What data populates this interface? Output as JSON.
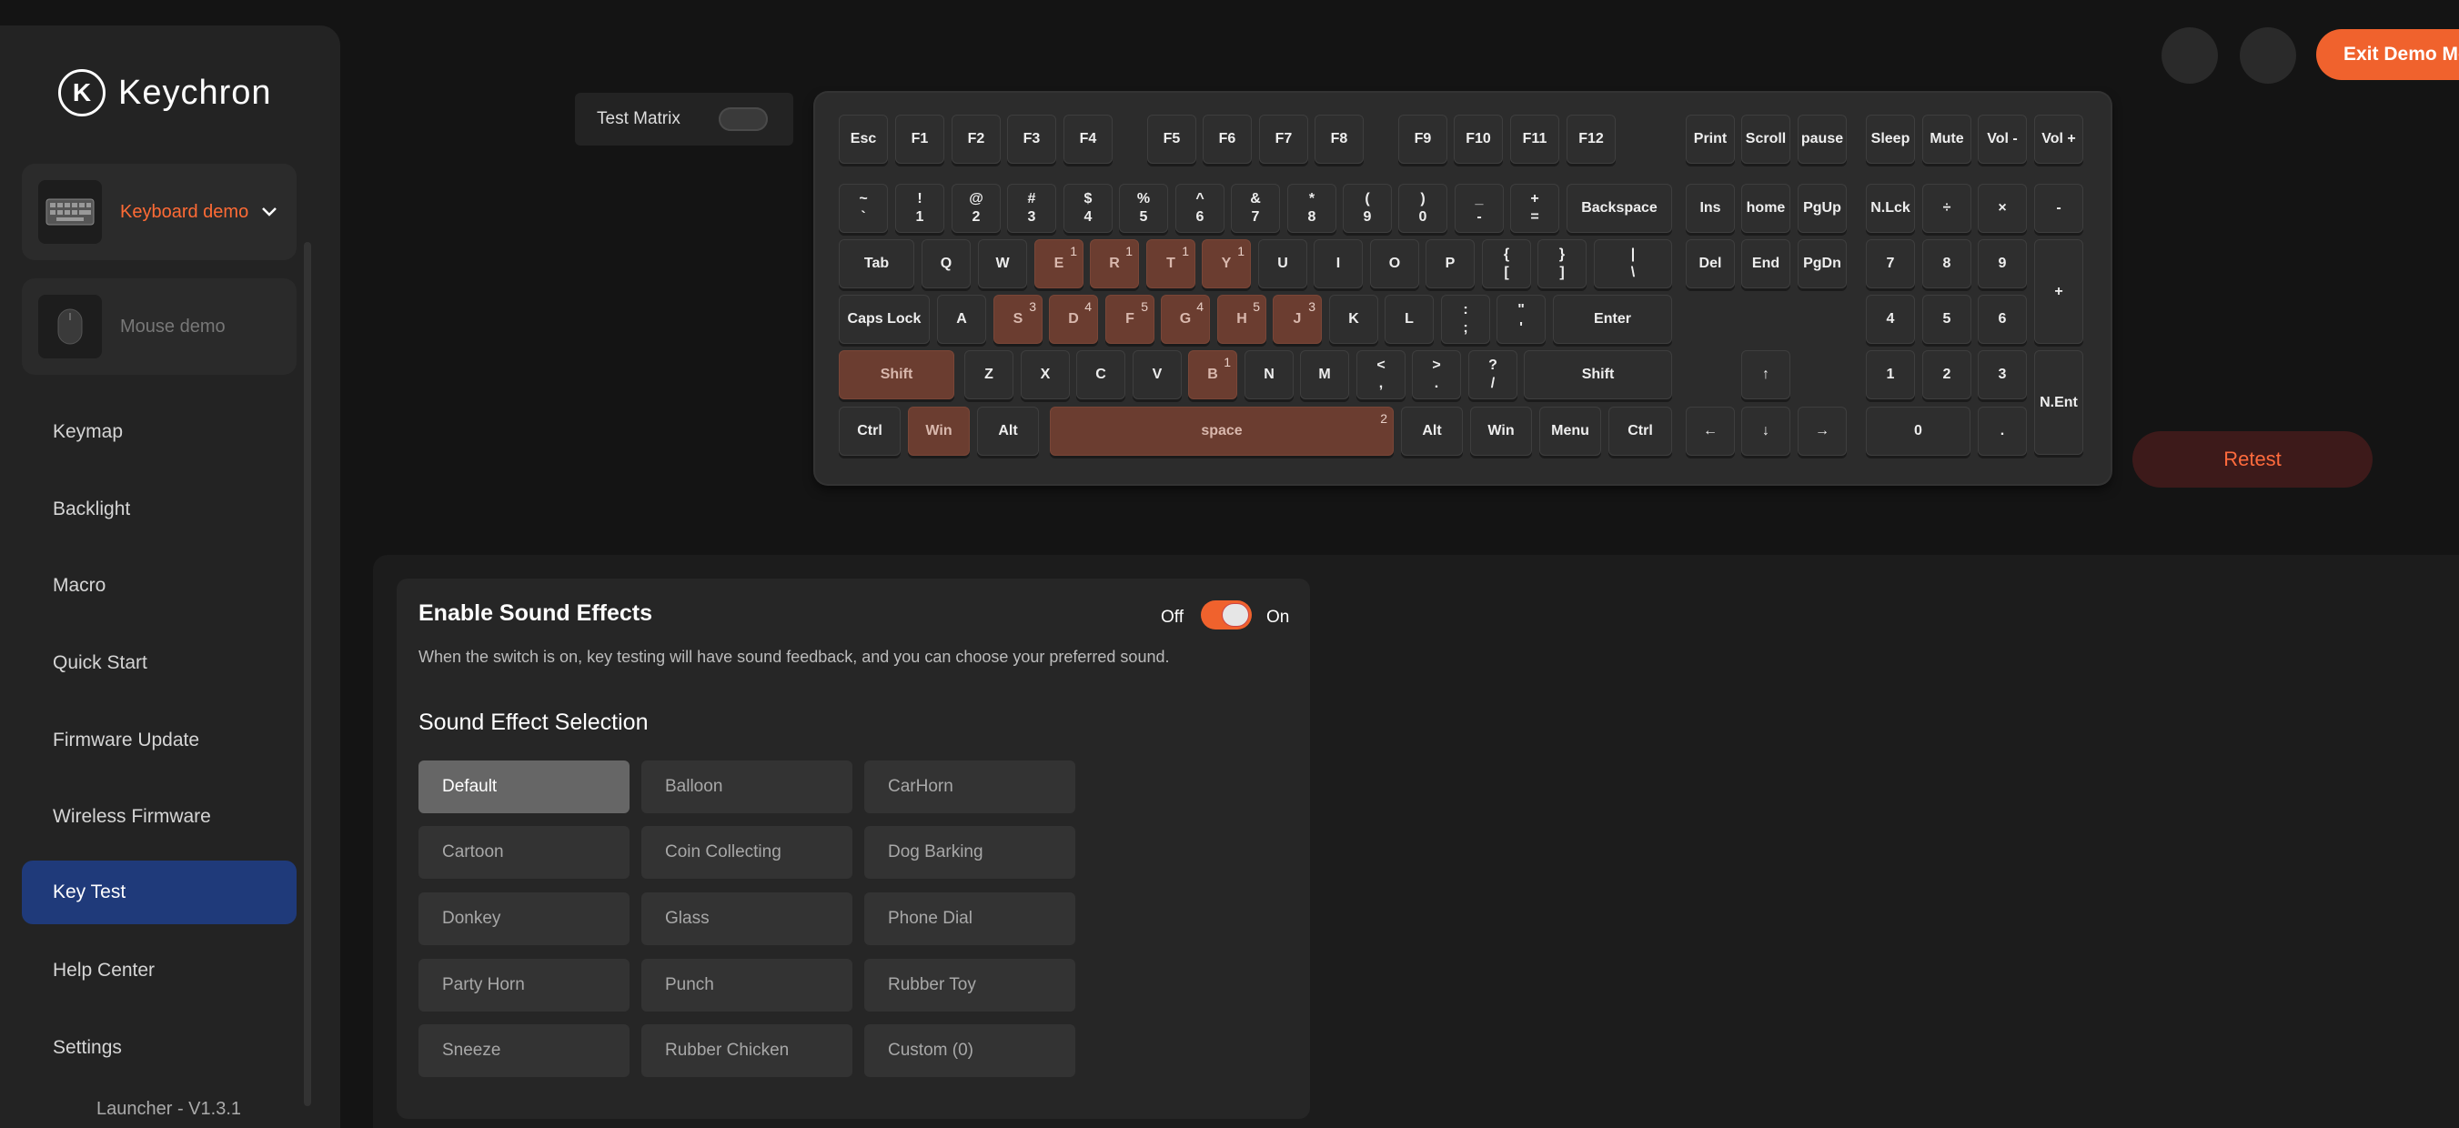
{
  "app": {
    "brand": "Keychron",
    "logo_letter": "K",
    "version": "Launcher - V1.3.1",
    "accent": "#f0622d"
  },
  "devices": [
    {
      "label": "Keyboard demo",
      "selected": true
    },
    {
      "label": "Mouse demo",
      "selected": false
    }
  ],
  "nav": [
    "Keymap",
    "Backlight",
    "Macro",
    "Quick Start",
    "Firmware Update",
    "Wireless Firmware",
    "Key Test",
    "Help Center",
    "Settings"
  ],
  "active_nav": "Key Test",
  "header": {
    "exit_label": "Exit Demo Mode"
  },
  "test_matrix": {
    "label": "Test Matrix",
    "enabled": false
  },
  "retest_label": "Retest",
  "keys": [
    {
      "t": "Esc"
    },
    {
      "t": "F1"
    },
    {
      "t": "F2"
    },
    {
      "t": "F3"
    },
    {
      "t": "F4"
    },
    {
      "t": "F5"
    },
    {
      "t": "F6"
    },
    {
      "t": "F7"
    },
    {
      "t": "F8"
    },
    {
      "t": "F9"
    },
    {
      "t": "F10"
    },
    {
      "t": "F11"
    },
    {
      "t": "F12"
    },
    {
      "t": "Print"
    },
    {
      "t": "Scroll"
    },
    {
      "t": "pause"
    },
    {
      "t": "Sleep"
    },
    {
      "t": "Mute"
    },
    {
      "t": "Vol -"
    },
    {
      "t": "Vol +"
    },
    {
      "t": "~",
      "b": "`"
    },
    {
      "t": "!",
      "b": "1"
    },
    {
      "t": "@",
      "b": "2"
    },
    {
      "t": "#",
      "b": "3"
    },
    {
      "t": "$",
      "b": "4"
    },
    {
      "t": "%",
      "b": "5"
    },
    {
      "t": "^",
      "b": "6"
    },
    {
      "t": "&",
      "b": "7"
    },
    {
      "t": "*",
      "b": "8"
    },
    {
      "t": "(",
      "b": "9"
    },
    {
      "t": ")",
      "b": "0"
    },
    {
      "t": "_",
      "b": "-"
    },
    {
      "t": "+",
      "b": "="
    },
    {
      "t": "Backspace"
    },
    {
      "t": "Ins"
    },
    {
      "t": "home"
    },
    {
      "t": "PgUp"
    },
    {
      "t": "N.Lck"
    },
    {
      "t": "÷"
    },
    {
      "t": "×"
    },
    {
      "t": "-"
    },
    {
      "t": "Tab"
    },
    {
      "t": "Q"
    },
    {
      "t": "W"
    },
    {
      "t": "E",
      "c": "1"
    },
    {
      "t": "R",
      "c": "1"
    },
    {
      "t": "T",
      "c": "1"
    },
    {
      "t": "Y",
      "c": "1"
    },
    {
      "t": "U"
    },
    {
      "t": "I"
    },
    {
      "t": "O"
    },
    {
      "t": "P"
    },
    {
      "t": "{",
      "b": "["
    },
    {
      "t": "}",
      "b": "]"
    },
    {
      "t": "|",
      "b": "\\"
    },
    {
      "t": "Del"
    },
    {
      "t": "End"
    },
    {
      "t": "PgDn"
    },
    {
      "t": "7"
    },
    {
      "t": "8"
    },
    {
      "t": "9"
    },
    {
      "t": "+"
    },
    {
      "t": "Caps Lock"
    },
    {
      "t": "A"
    },
    {
      "t": "S",
      "c": "3"
    },
    {
      "t": "D",
      "c": "4"
    },
    {
      "t": "F",
      "c": "5"
    },
    {
      "t": "G",
      "c": "4"
    },
    {
      "t": "H",
      "c": "5"
    },
    {
      "t": "J",
      "c": "3"
    },
    {
      "t": "K"
    },
    {
      "t": "L"
    },
    {
      "t": ":",
      "b": ";"
    },
    {
      "t": "\"",
      "b": "'"
    },
    {
      "t": "Enter"
    },
    {
      "t": "4"
    },
    {
      "t": "5"
    },
    {
      "t": "6"
    },
    {
      "t": "Shift",
      "h": 1
    },
    {
      "t": "Z"
    },
    {
      "t": "X"
    },
    {
      "t": "C"
    },
    {
      "t": "V"
    },
    {
      "t": "B",
      "c": "1"
    },
    {
      "t": "N"
    },
    {
      "t": "M"
    },
    {
      "t": "<",
      "b": ","
    },
    {
      "t": ">",
      "b": "."
    },
    {
      "t": "?",
      "b": "/"
    },
    {
      "t": "Shift"
    },
    {
      "t": "↑"
    },
    {
      "t": "1"
    },
    {
      "t": "2"
    },
    {
      "t": "3"
    },
    {
      "t": "N.Ent"
    },
    {
      "t": "Ctrl"
    },
    {
      "t": "Win",
      "h": 1
    },
    {
      "t": "Alt"
    },
    {
      "t": "space",
      "c": "2"
    },
    {
      "t": "Alt"
    },
    {
      "t": "Win"
    },
    {
      "t": "Menu"
    },
    {
      "t": "Ctrl"
    },
    {
      "t": "←"
    },
    {
      "t": "↓"
    },
    {
      "t": "→"
    },
    {
      "t": "0"
    },
    {
      "t": "."
    }
  ],
  "sound": {
    "title": "Enable Sound Effects",
    "off": "Off",
    "on": "On",
    "enabled": true,
    "description": "When the switch is on, key testing will have sound feedback, and you can choose your preferred sound.",
    "selection_title": "Sound Effect Selection",
    "selected": "Default",
    "options": [
      "Default",
      "Balloon",
      "CarHorn",
      "Cartoon",
      "Coin Collecting",
      "Dog Barking",
      "Donkey",
      "Glass",
      "Phone Dial",
      "Party Horn",
      "Punch",
      "Rubber Toy",
      "Sneeze",
      "Rubber Chicken",
      "Custom (0)"
    ]
  }
}
